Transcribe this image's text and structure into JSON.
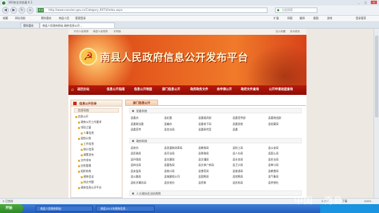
{
  "browser": {
    "title": "360安全浏览器 6.1",
    "window_controls": [
      "_",
      "□",
      "×"
    ],
    "address_label": "安全",
    "url": "http://www.nanxian.gov.cn/Category_9073/Index.aspx",
    "search_placeholder": "点此搜索",
    "bookmarks": [
      "收藏",
      "网址导航",
      "猜你喜欢",
      "南县人民",
      "管理登录"
    ],
    "bookmark_right": [
      "扩展",
      "网银",
      "翻译",
      "截图",
      "游戏",
      "登录管家"
    ],
    "tabs": [
      {
        "label": "猜你喜欢",
        "active": false
      },
      {
        "label": "南县人民政府网站-政府信息公开...",
        "active": true
      }
    ]
  },
  "site": {
    "top_links_left": [
      "中共人民政府",
      "南县人民政府",
      "手机版"
    ],
    "top_links_right": [
      "加入收藏",
      "设为首页"
    ],
    "banner_title": "南县人民政府信息公开发布平台",
    "nav": [
      "返回主站",
      "信息公开指南",
      "信息公开制度",
      "部门信息公开",
      "政府政务文件",
      "依申请公开",
      "政府文件查询",
      "公开申请进度查询"
    ]
  },
  "left_panel": {
    "heading": "信息公开目录",
    "sub": "信息导航",
    "tree": [
      {
        "label": "信息公开",
        "level": 0
      },
      {
        "label": "政府公开工作要求",
        "level": 1
      },
      {
        "label": "领导之窗",
        "level": 1
      },
      {
        "label": "人事信息",
        "level": 2
      },
      {
        "label": "规划计划",
        "level": 1
      },
      {
        "label": "工作信息",
        "level": 2
      },
      {
        "label": "统计信息",
        "level": 2
      },
      {
        "label": "政策发布",
        "level": 2
      },
      {
        "label": "文件发布",
        "level": 1
      },
      {
        "label": "应急管理",
        "level": 1
      },
      {
        "label": "组织机构",
        "level": 1
      },
      {
        "label": "政府会议",
        "level": 2
      },
      {
        "label": "热点专题",
        "level": 2
      },
      {
        "label": "政府信息公开平台",
        "level": 1
      }
    ]
  },
  "right_panel": {
    "tab": "部门信息公开",
    "sections": [
      {
        "title": "党委系统",
        "links": [
          "县委办",
          "县纪委",
          "县委组织部",
          "县委宣传部",
          "县委统战部",
          "县委政法委",
          "县编办",
          "县委老干局",
          "县委党校",
          "县档案局",
          "县委宣传",
          "县信访局",
          "县委研究室",
          "县委"
        ]
      },
      {
        "title": "政府系统",
        "links": [
          "县府办",
          "县发展和改革局",
          "县教育局",
          "县科工局",
          "县公安局",
          "县民政局",
          "县司法局",
          "县财政局",
          "县人社局",
          "县国土局",
          "县环保局",
          "县住建局",
          "县交通局",
          "县水务局",
          "县农业局",
          "县林业局",
          "县畜牧局",
          "县文体广新局",
          "县卫计局",
          "县审计局",
          "县安监局",
          "县统计局",
          "县食药局",
          "县旅游局",
          "县粮食局",
          "县公路局",
          "县城建投公司",
          "县国税局",
          "县地税局",
          "县气象局",
          "县机关事务局",
          "县扶贫办",
          "县侨联",
          "县农机局",
          "县供销社"
        ]
      },
      {
        "title": "人大政协及法检两院",
        "links": []
      }
    ]
  },
  "statusbar": {
    "left": "0 已完成",
    "right": [
      "0 安全",
      "下载",
      "100%"
    ]
  },
  "taskbar": {
    "start": "开始",
    "tasks": [
      "南县人民政府网站",
      "南县2015年政府信息..."
    ]
  },
  "watermark": "中国 · 南县",
  "colors": {
    "banner_red": "#d23a14",
    "nav_red": "#a5140a",
    "taskbar_blue": "#245dbb"
  }
}
